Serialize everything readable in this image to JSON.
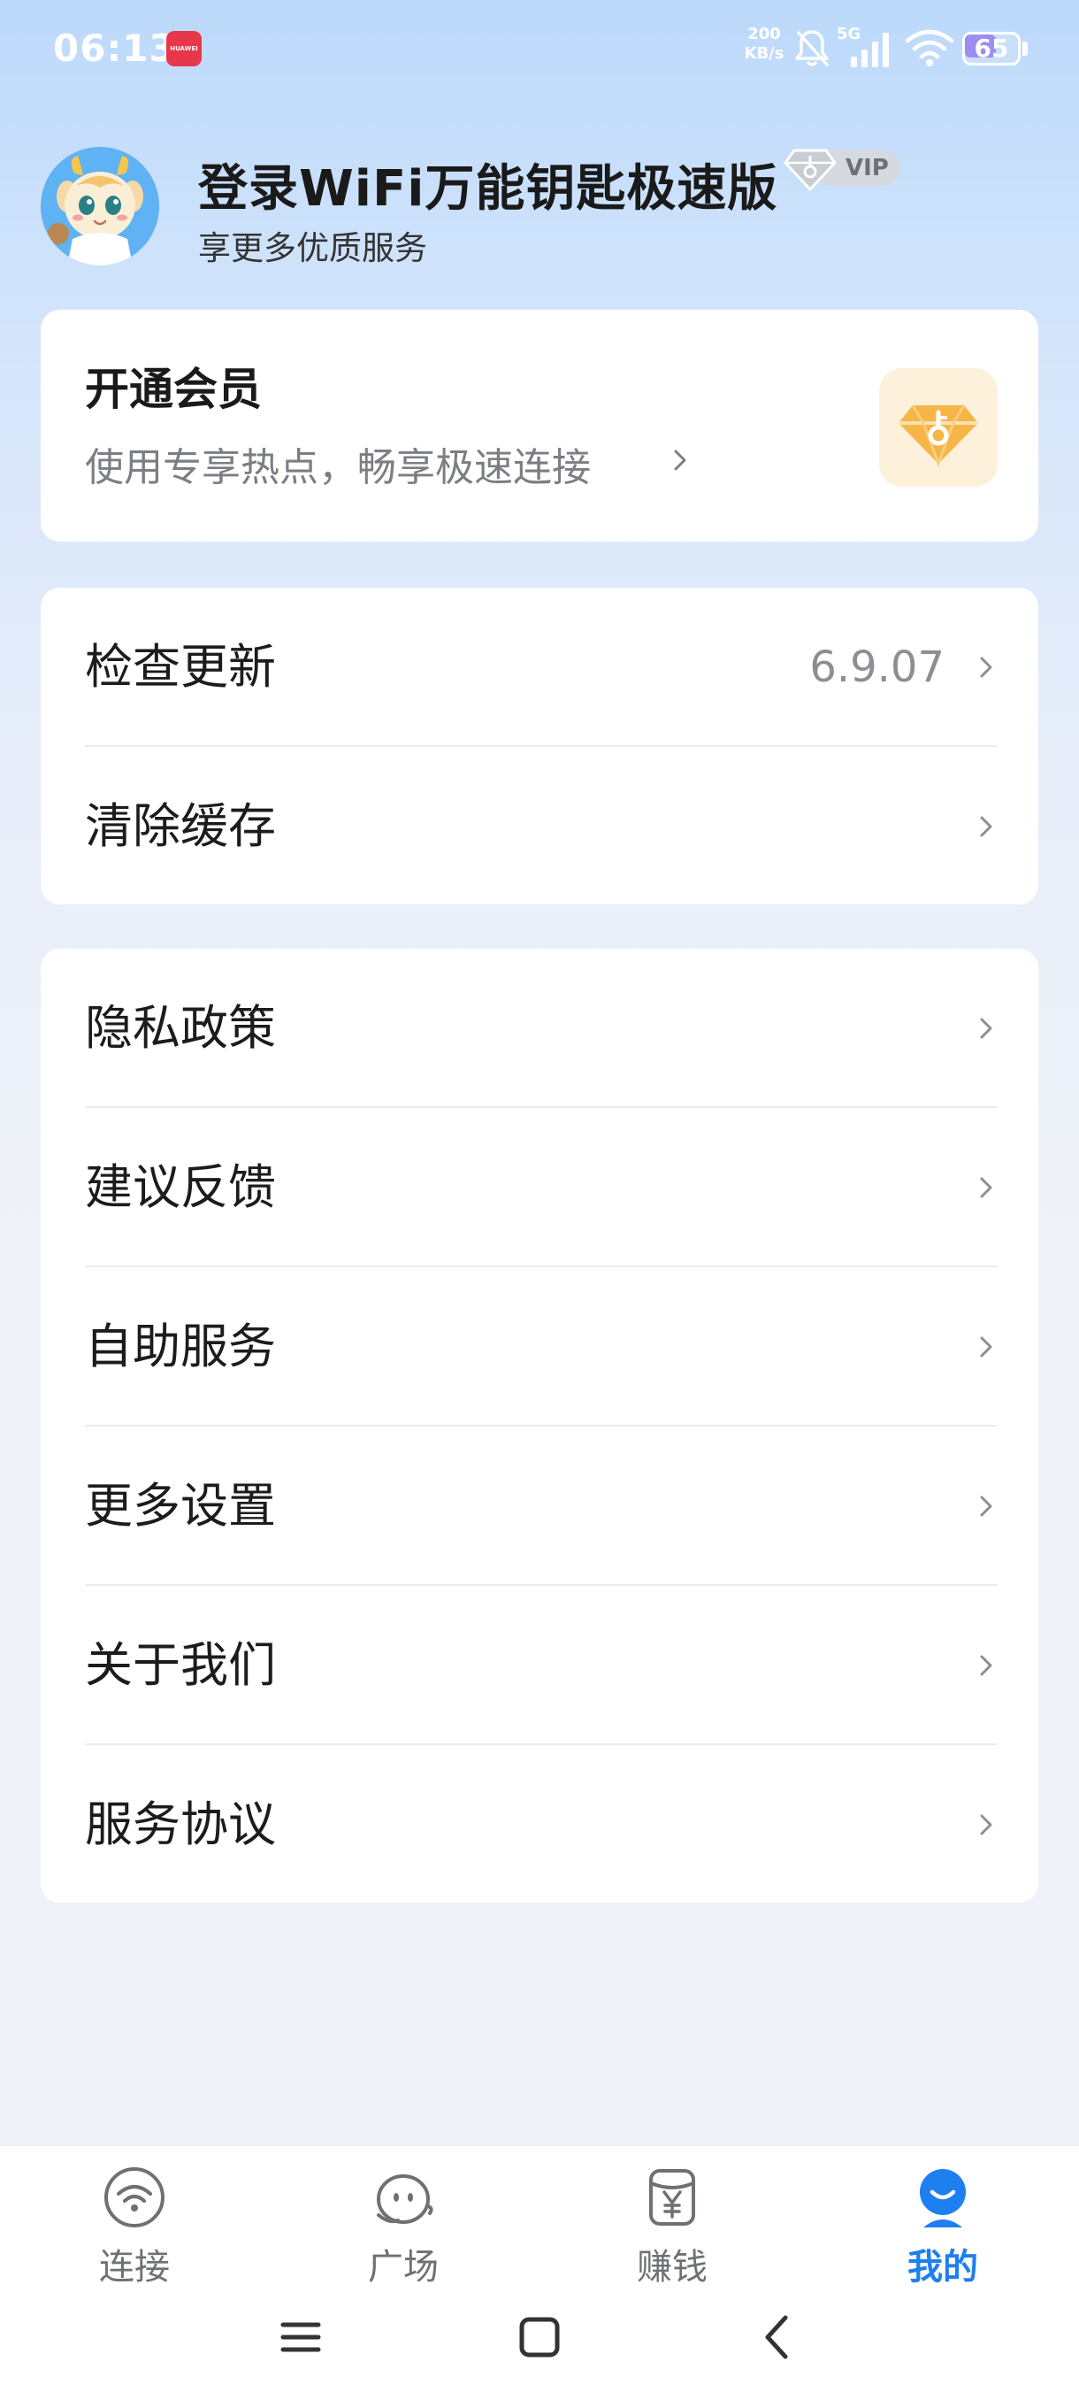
{
  "status_bar": {
    "time": "06:13",
    "app_icon_label": "HUAWEI",
    "net_speed_value": "200",
    "net_speed_unit": "KB/s",
    "network_type": "5G",
    "battery": "65",
    "battery_level_percent": 65
  },
  "profile": {
    "title": "登录WiFi万能钥匙极速版",
    "subtitle": "享更多优质服务",
    "vip_label": "VIP"
  },
  "member_card": {
    "title": "开通会员",
    "subtitle": "使用专享热点，畅享极速连接"
  },
  "settings_group_1": [
    {
      "label": "检查更新",
      "value": "6.9.07"
    },
    {
      "label": "清除缓存",
      "value": ""
    }
  ],
  "settings_group_2": [
    {
      "label": "隐私政策"
    },
    {
      "label": "建议反馈"
    },
    {
      "label": "自助服务"
    },
    {
      "label": "更多设置"
    },
    {
      "label": "关于我们"
    },
    {
      "label": "服务协议"
    }
  ],
  "bottom_nav": {
    "items": [
      {
        "label": "连接",
        "icon": "wifi-icon",
        "active": false
      },
      {
        "label": "广场",
        "icon": "chat-face-icon",
        "active": false
      },
      {
        "label": "赚钱",
        "icon": "yen-icon",
        "active": false
      },
      {
        "label": "我的",
        "icon": "profile-icon",
        "active": true
      }
    ]
  },
  "colors": {
    "accent": "#1e7ff0",
    "background_top": "#bcd9fb",
    "background_bottom": "#eff2f8",
    "vip_gold": "#f5b547"
  }
}
